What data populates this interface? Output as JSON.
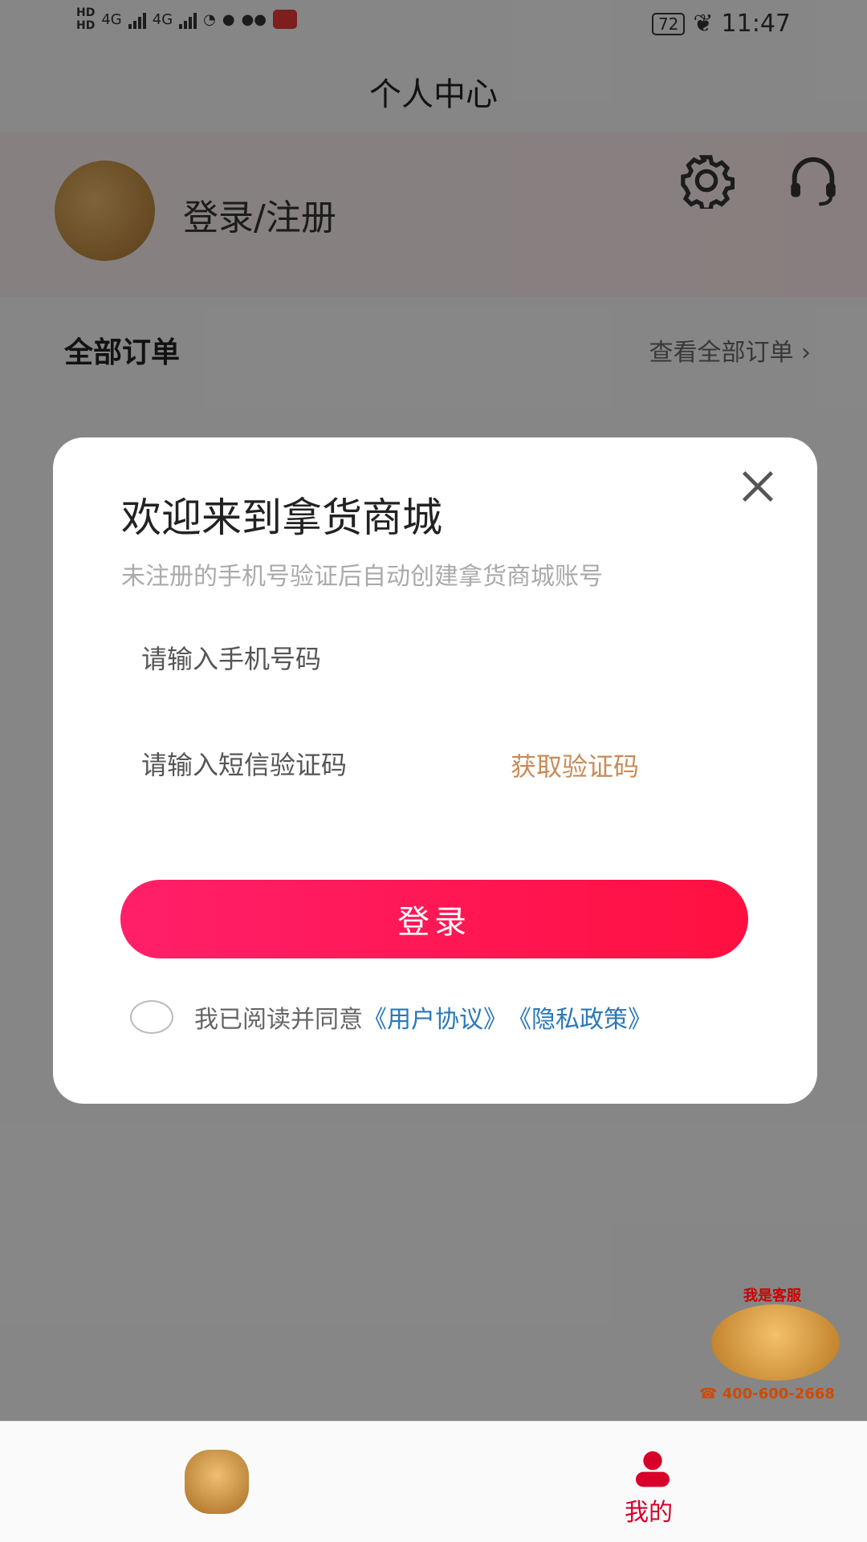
{
  "status_bar": {
    "hd1": "HD",
    "hd2": "HD",
    "net1": "4G",
    "net2": "4G",
    "battery": "72",
    "time": "11:47"
  },
  "page": {
    "title": "个人中心"
  },
  "profile": {
    "login_register": "登录/注册"
  },
  "orders": {
    "title": "全部订单",
    "view_all": "查看全部订单 ›"
  },
  "modal": {
    "title": "欢迎来到拿货商城",
    "subtitle": "未注册的手机号验证后自动创建拿货商城账号",
    "phone_placeholder": "请输入手机号码",
    "code_placeholder": "请输入短信验证码",
    "get_code": "获取验证码",
    "login": "登录",
    "agree_text": "我已阅读并同意",
    "user_agreement": "《用户协议》",
    "privacy_policy": "《隐私政策》"
  },
  "customer_service": {
    "title": "我是客服",
    "phone": "400-600-2668"
  },
  "bottom_nav": {
    "mine": "我的"
  },
  "colors": {
    "primary": "#ff1f6a",
    "link": "#2a78ba",
    "accent": "#c98b57"
  }
}
